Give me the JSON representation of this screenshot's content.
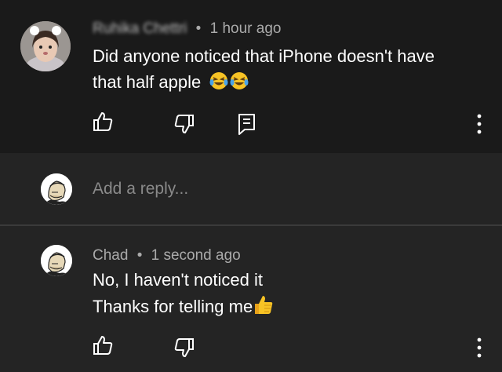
{
  "top_comment": {
    "author": "Ruhika Chettri",
    "separator": "•",
    "time": "1 hour ago",
    "line1": "Did anyone noticed that iPhone doesn't have",
    "line2": "that half apple",
    "emoji": "laughing-crying-face-icon"
  },
  "reply_box": {
    "placeholder": "Add a reply..."
  },
  "reply_comment": {
    "author": "Chad",
    "separator": "•",
    "time": "1 second ago",
    "line1": "No, I haven't noticed it",
    "line2": "Thanks for telling me",
    "emoji": "thumbs-up-emoji-icon"
  },
  "colors": {
    "background_top": "#1a1a1a",
    "background_reply": "#242424",
    "text_primary": "#ffffff",
    "text_meta": "#aaaaaa",
    "placeholder": "#8a8a8a"
  }
}
